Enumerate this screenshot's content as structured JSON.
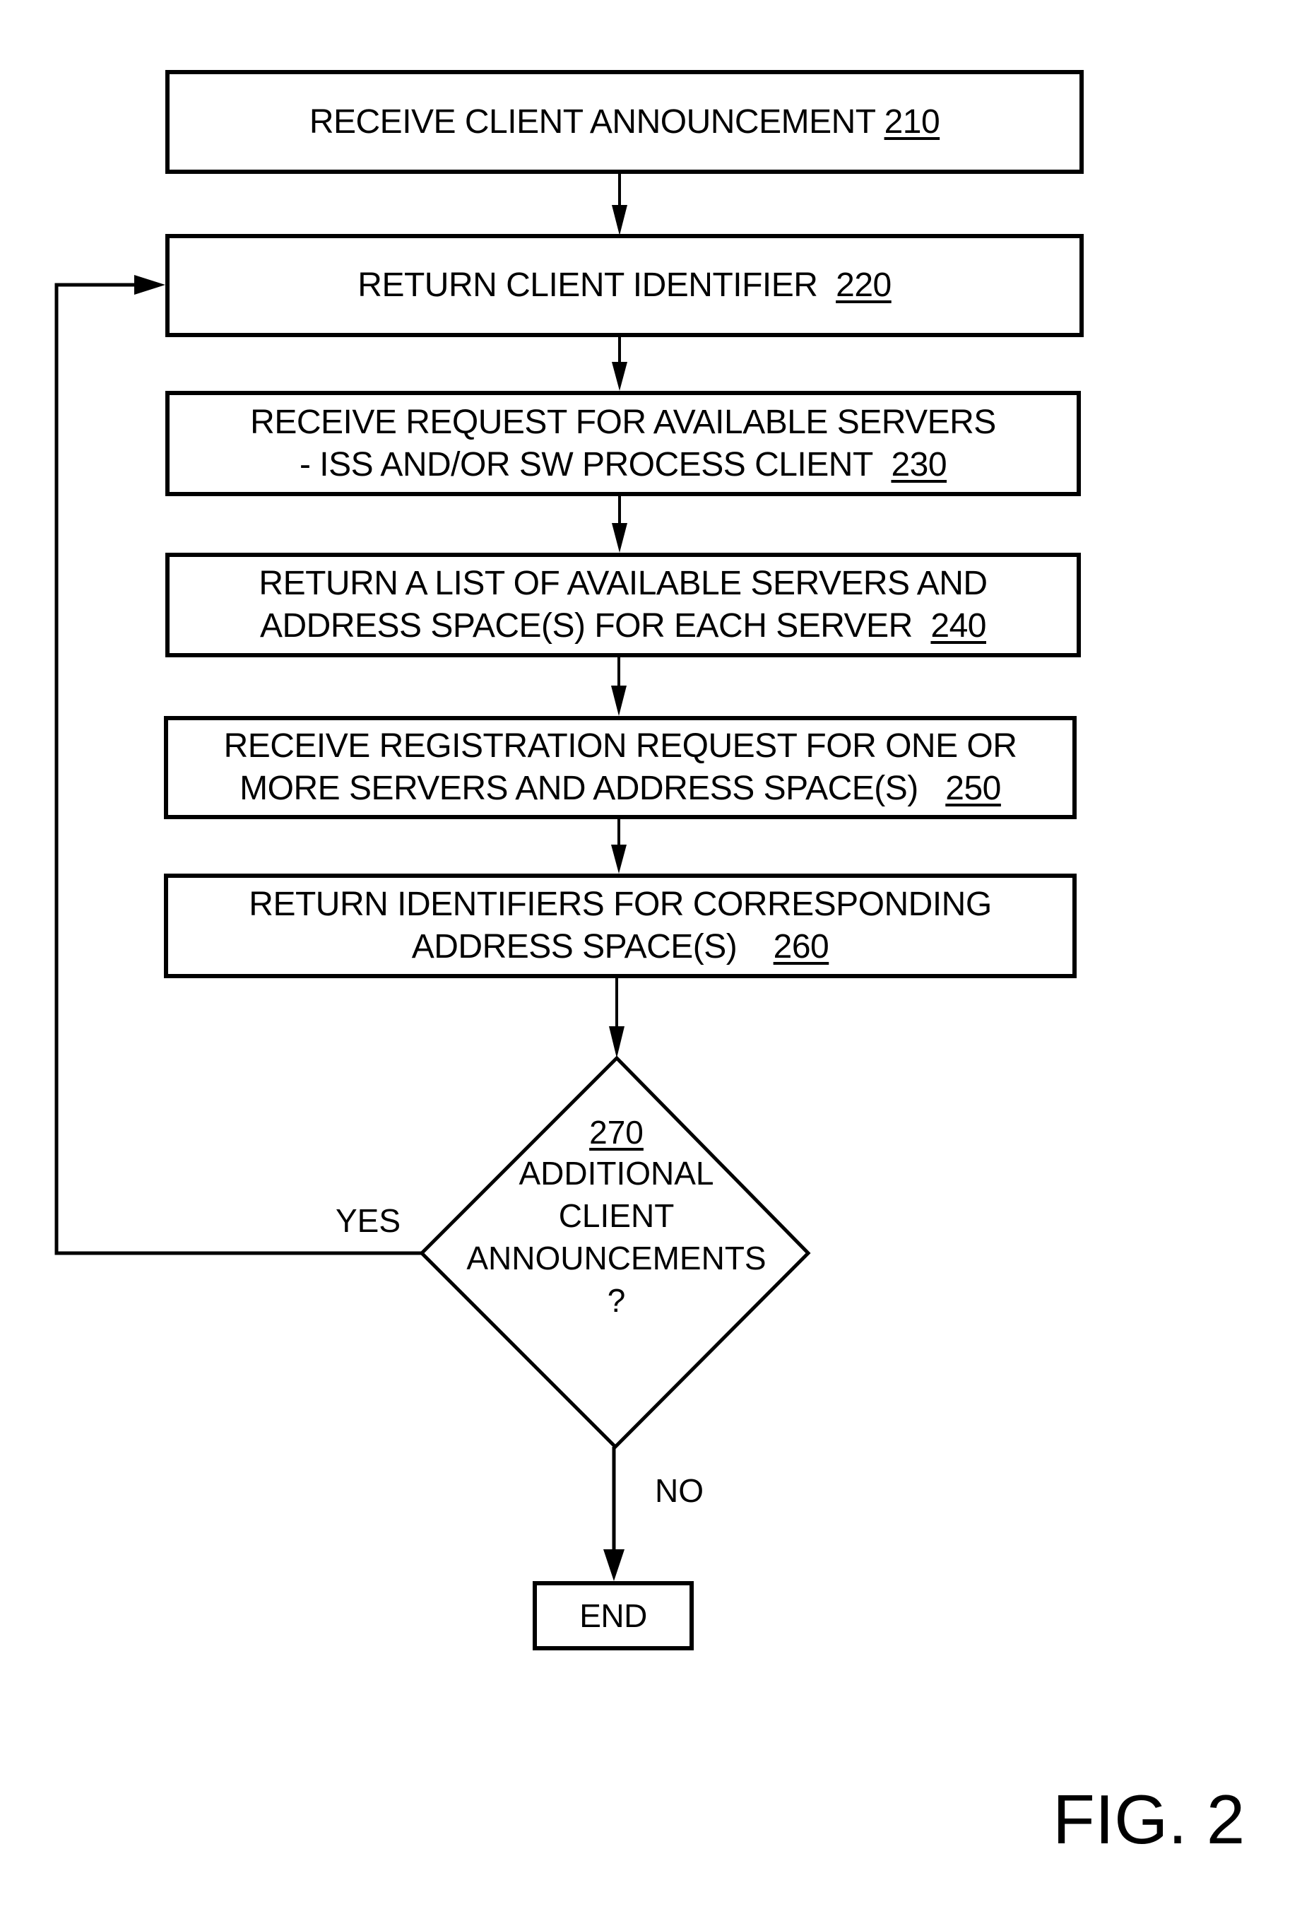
{
  "figure_label": "FIG. 2",
  "steps": [
    {
      "id": "210",
      "lines": [
        "RECEIVE CLIENT ANNOUNCEMENT"
      ],
      "ref": "210"
    },
    {
      "id": "220",
      "lines": [
        "RETURN CLIENT IDENTIFIER"
      ],
      "ref": "220"
    },
    {
      "id": "230",
      "lines": [
        "RECEIVE REQUEST FOR AVAILABLE SERVERS",
        "- ISS AND/OR SW PROCESS CLIENT"
      ],
      "ref": "230"
    },
    {
      "id": "240",
      "lines": [
        "RETURN A LIST OF AVAILABLE SERVERS AND",
        "ADDRESS SPACE(S) FOR EACH SERVER"
      ],
      "ref": "240"
    },
    {
      "id": "250",
      "lines": [
        "RECEIVE REGISTRATION REQUEST FOR ONE OR",
        "MORE SERVERS AND ADDRESS SPACE(S)"
      ],
      "ref": "250"
    },
    {
      "id": "260",
      "lines": [
        "RETURN IDENTIFIERS FOR CORRESPONDING",
        "ADDRESS SPACE(S)"
      ],
      "ref": "260"
    }
  ],
  "decision": {
    "ref": "270",
    "lines": [
      "ADDITIONAL",
      "CLIENT",
      "ANNOUNCEMENTS",
      "?"
    ],
    "yes_label": "YES",
    "no_label": "NO"
  },
  "end_label": "END"
}
